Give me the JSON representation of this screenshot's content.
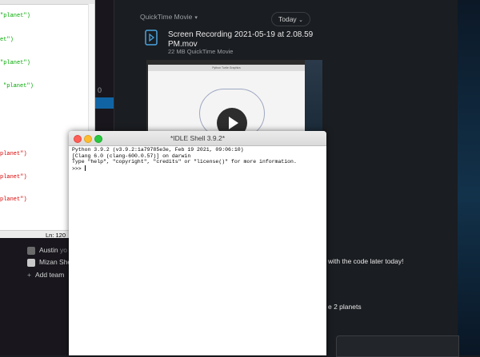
{
  "chat": {
    "file_type_label": "QuickTime Movie",
    "today_label": "Today",
    "file": {
      "title": "Screen Recording 2021-05-19 at 2.08.59 PM.mov",
      "meta": "22 MB QuickTime Movie",
      "video_title": "Python Turtle Graphics"
    },
    "sidebar_fragment": "0",
    "members": [
      {
        "name": "Austin",
        "sub": "yo",
        "color": "#6b6b6b"
      },
      {
        "name": "Mizan She",
        "sub": "",
        "color": "#c9c9c9"
      }
    ],
    "add_teammates": "Add team",
    "message_1_fragment": "with the code later today!",
    "message_2_fragment": "e 2 planets",
    "colors": {
      "selection": "#1164a3",
      "accent_blue": "#4aa3df"
    }
  },
  "editor": {
    "lines": [
      {
        "pre": "",
        "str": "\"planet\")",
        "color": "green"
      },
      {
        "pre": "",
        "str": "et\")",
        "color": "green"
      },
      {
        "pre": "",
        "str": "\"planet\")",
        "color": "green"
      },
      {
        "pre": "",
        "str": "\"planet\")",
        "color": "green"
      },
      {
        "pre": "",
        "str": "planet\")",
        "color": "red"
      },
      {
        "pre": "",
        "str": "planet\")",
        "color": "red"
      },
      {
        "pre": "",
        "str": "planet\")",
        "color": "red"
      }
    ],
    "status": "Ln: 120"
  },
  "idle": {
    "title": "*IDLE Shell 3.9.2*",
    "lines": [
      "Python 3.9.2 (v3.9.2:1a79785e3e, Feb 19 2021, 09:06:10)",
      "[Clang 6.0 (clang-600.0.57)] on darwin",
      "Type \"help\", \"copyright\", \"credits\" or \"license()\" for more information."
    ],
    "prompt": ">>> "
  }
}
